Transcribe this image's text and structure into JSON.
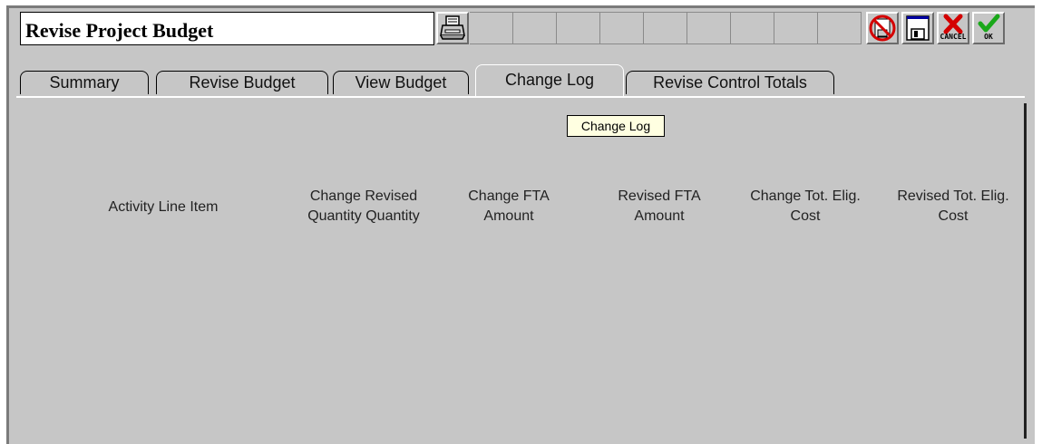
{
  "window": {
    "title": "Revise Project Budget"
  },
  "toolbar": {
    "print_icon": "printer-icon",
    "delete_icon": "no-save-icon",
    "save_icon": "floppy-disk-icon",
    "cancel_label": "CANCEL",
    "ok_label": "OK"
  },
  "tabs": [
    {
      "label": "Summary",
      "active": false
    },
    {
      "label": "Revise Budget",
      "active": false
    },
    {
      "label": "View Budget",
      "active": false
    },
    {
      "label": "Change Log",
      "active": true
    },
    {
      "label": "Revise Control Totals",
      "active": false
    }
  ],
  "tooltip": "Change Log",
  "columns": [
    {
      "line1": "Activity Line Item",
      "line2": ""
    },
    {
      "line1": "Change Revised",
      "line2": "Quantity Quantity"
    },
    {
      "line1": "Change FTA",
      "line2": "Amount"
    },
    {
      "line1": "Revised FTA",
      "line2": "Amount"
    },
    {
      "line1": "Change Tot. Elig.",
      "line2": "Cost"
    },
    {
      "line1": "Revised Tot. Elig.",
      "line2": "Cost"
    }
  ],
  "colors": {
    "background": "#c6c6c6",
    "cancel_red": "#d40000",
    "ok_green": "#1aa81a",
    "tooltip_bg": "#ffffe1"
  }
}
